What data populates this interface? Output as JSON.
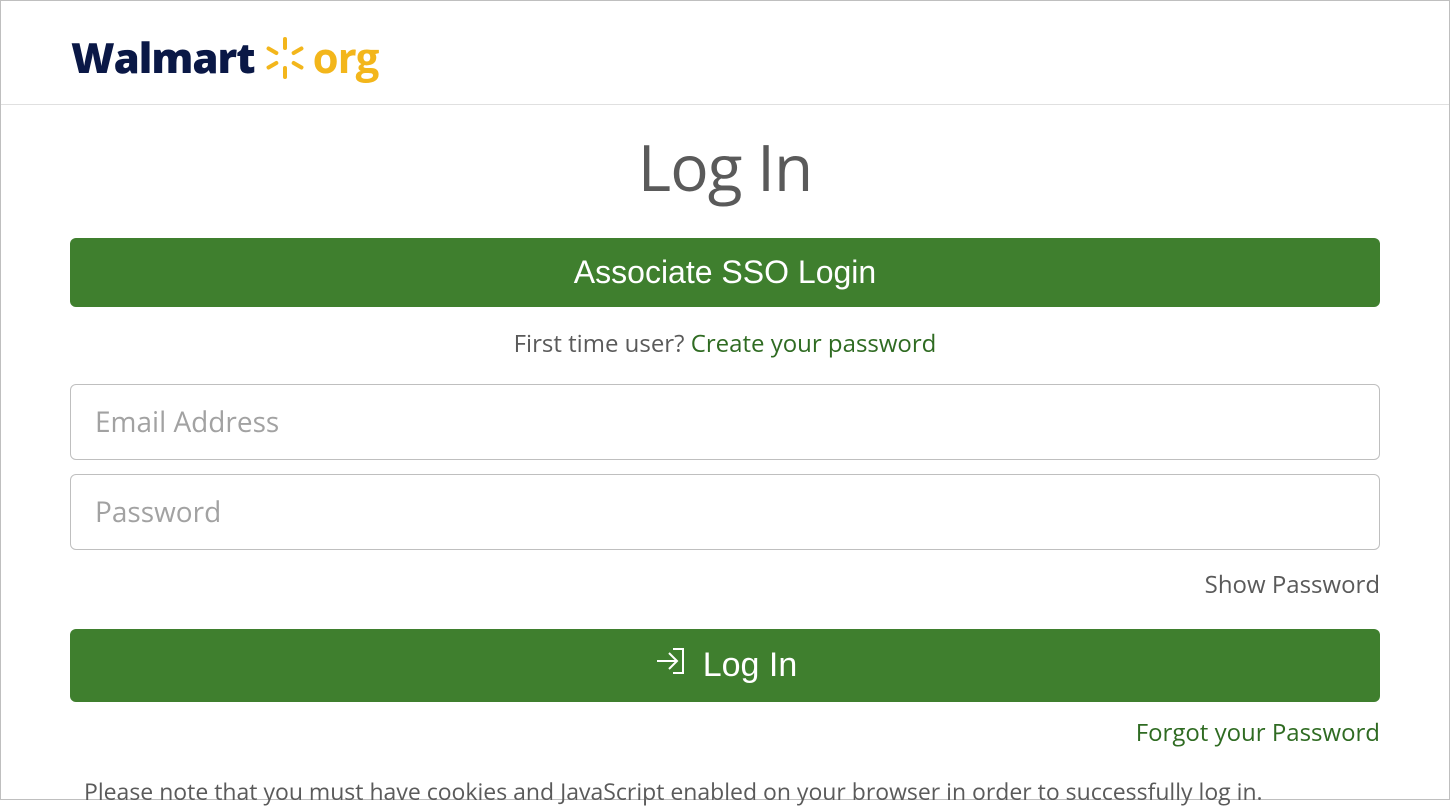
{
  "header": {
    "logo_walmart": "Walmart",
    "logo_org": "org"
  },
  "page": {
    "title": "Log In",
    "sso_button": "Associate SSO Login",
    "first_time_prefix": "First time user? ",
    "create_password_link": "Create your password",
    "email_placeholder": "Email Address",
    "password_placeholder": "Password",
    "show_password": "Show Password",
    "login_button": "Log In",
    "forgot_password": "Forgot your  Password",
    "cookies_note": "Please note that you must have cookies and JavaScript enabled on your browser in order to successfully log in."
  }
}
